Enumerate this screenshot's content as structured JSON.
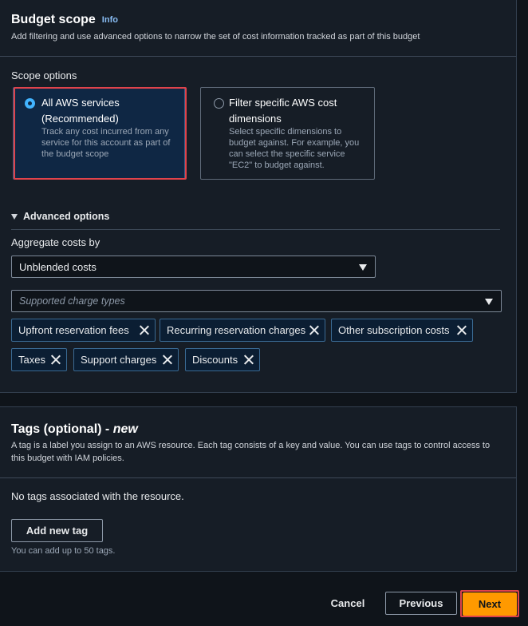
{
  "budget_scope": {
    "title": "Budget scope",
    "info_label": "Info",
    "description": "Add filtering and use advanced options to narrow the set of cost information tracked as part of this budget",
    "scope_options_label": "Scope options",
    "options": [
      {
        "title": "All AWS services (Recommended)",
        "description": "Track any cost incurred from any service for this account as part of the budget scope",
        "selected": true
      },
      {
        "title": "Filter specific AWS cost dimensions",
        "description": "Select specific dimensions to budget against. For example, you can select the specific service \"EC2\" to budget against.",
        "selected": false
      }
    ]
  },
  "advanced_options": {
    "label": "Advanced options",
    "aggregate_label": "Aggregate costs by",
    "aggregate_value": "Unblended costs",
    "charge_types_placeholder": "Supported charge types",
    "tokens": [
      "Upfront reservation fees",
      "Recurring reservation charges",
      "Other subscription costs",
      "Taxes",
      "Support charges",
      "Discounts"
    ]
  },
  "tags": {
    "title": "Tags (optional) - ",
    "title_new": "new",
    "description": "A tag is a label you assign to an AWS resource. Each tag consists of a key and value. You can use tags to control access to this budget with IAM policies.",
    "empty_text": "No tags associated with the resource.",
    "add_button": "Add new tag",
    "hint": "You can add up to 50 tags."
  },
  "footer": {
    "cancel": "Cancel",
    "previous": "Previous",
    "next": "Next"
  },
  "colors": {
    "accent": "#ff9900",
    "highlight": "#e0434b",
    "link": "#89bdf4",
    "radio_selected": "#42b4ff"
  }
}
